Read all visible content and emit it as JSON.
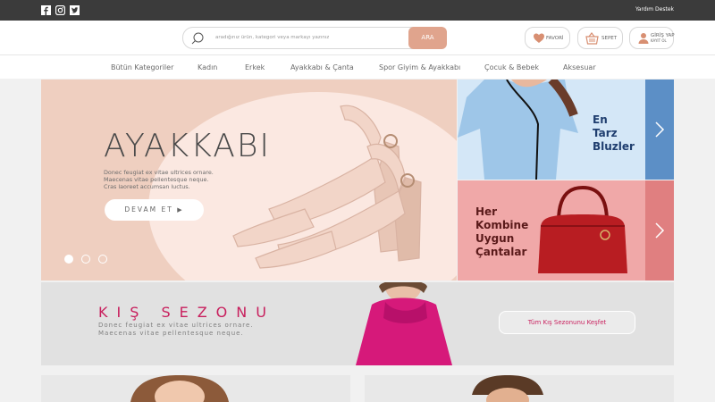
{
  "topbar": {
    "help_label": "Yardım Destek",
    "social": [
      "facebook-icon",
      "instagram-icon",
      "twitter-icon"
    ]
  },
  "search": {
    "placeholder": "aradığınız ürün, kategori veya markayı yazınız",
    "button_label": "ARA"
  },
  "header": {
    "favorites_label": "FAVORİ",
    "cart_label": "SEPET",
    "login_label": "GİRİŞ YAP",
    "register_label": "KAYIT OL"
  },
  "nav": {
    "items": [
      "Bütün Kategoriler",
      "Kadın",
      "Erkek",
      "Ayakkabı & Çanta",
      "Spor Giyim & Ayakkabı",
      "Çocuk & Bebek",
      "Aksesuar"
    ]
  },
  "hero": {
    "title": "AYAKKABI",
    "desc_line1": "Donec feugiat ex vitae ultrices ornare.",
    "desc_line2": "Maecenas vitae pellentesque neque.",
    "desc_line3": "Cras laoreet accumsan luctus.",
    "cta_label": "DEVAM ET",
    "cta_arrow": "▶",
    "slides_total": 3,
    "active_slide": 1
  },
  "side_banners": [
    {
      "line1": "En",
      "line2": "Tarz",
      "line3": "Bluzler"
    },
    {
      "line1": "Her",
      "line2": "Kombine",
      "line3": "Uygun",
      "line4": "Çantalar"
    }
  ],
  "winter": {
    "title": "KIŞ SEZONU",
    "desc_line1": "Donec feugiat ex vitae ultrices ornare.",
    "desc_line2": "Maecenas vitae pellentesque neque.",
    "cta_label": "Tüm Kış Sezonunu Keşfet"
  },
  "colors": {
    "accent": "#e0a48d",
    "winter_accent": "#c81f5d",
    "topbar": "#3b3b3b"
  }
}
